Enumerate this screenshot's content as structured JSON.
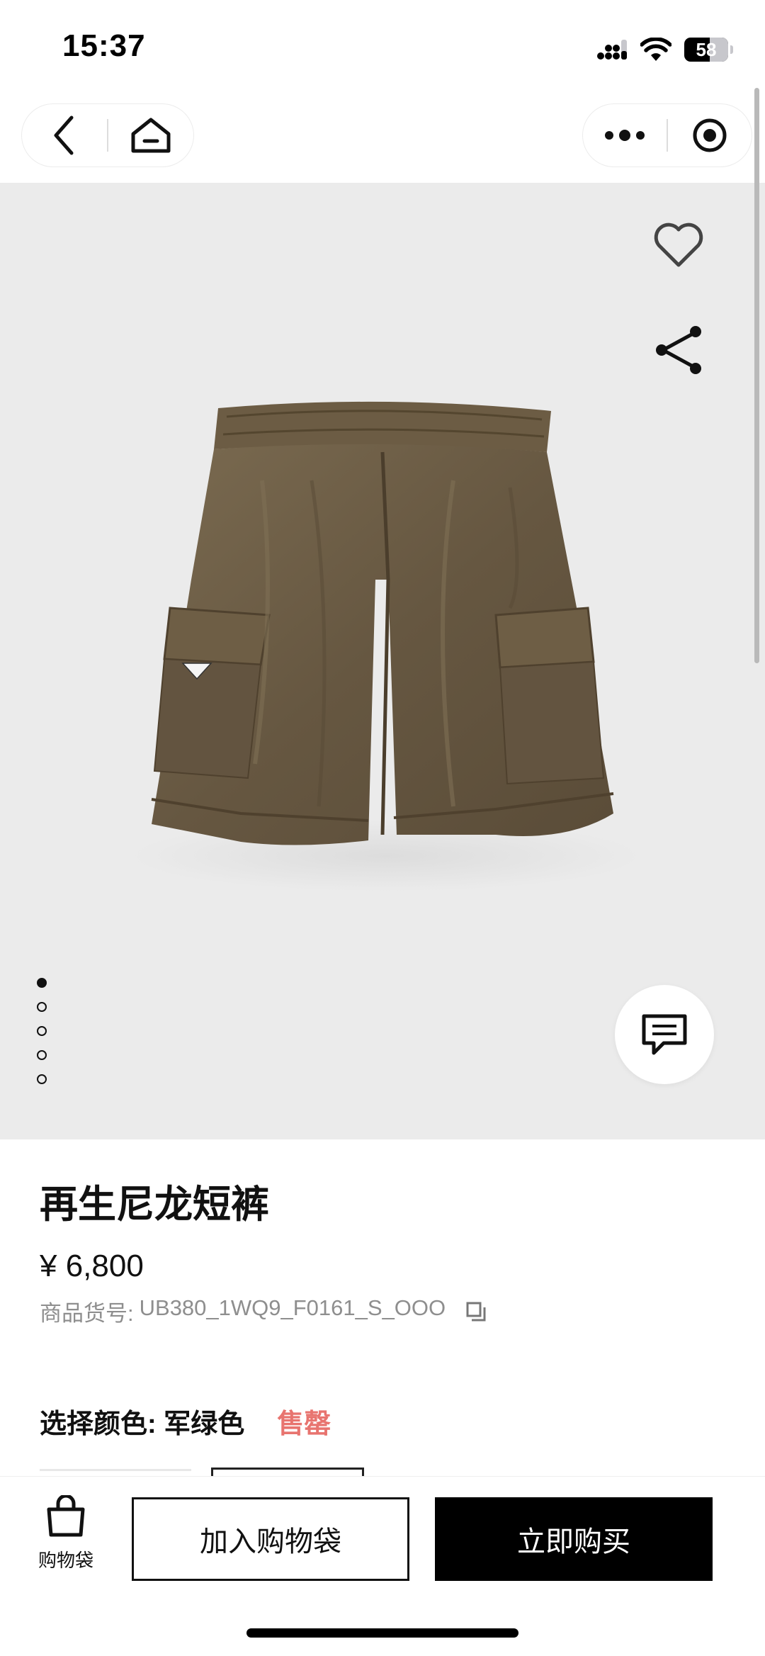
{
  "status_bar": {
    "time": "15:37",
    "battery": "58",
    "icons": [
      "signal-icon",
      "wifi-icon",
      "battery-icon"
    ]
  },
  "nav": {
    "left_icons": [
      "back-icon",
      "home-icon"
    ],
    "right_icons": [
      "more-icon",
      "capsule-close-icon"
    ]
  },
  "hero": {
    "image": "cargo-shorts-photo",
    "slide_count": 5,
    "active_slide": 1,
    "actions": [
      "heart-icon",
      "share-icon",
      "chat-icon"
    ]
  },
  "product": {
    "title": "再生尼龙短裤",
    "price": "¥ 6,800",
    "sku_label": "商品货号:",
    "sku_value": "UB380_1WQ9_F0161_S_OOO",
    "color_label": "选择颜色: 军绿色",
    "stock_status": "售罄"
  },
  "bottom_bar": {
    "bag_label": "购物袋",
    "add_to_bag": "加入购物袋",
    "buy_now": "立即购买"
  },
  "colors": {
    "accent_sold_out": "#e8746f",
    "hero_bg": "#ebebeb",
    "shorts": "#6f5e45"
  }
}
